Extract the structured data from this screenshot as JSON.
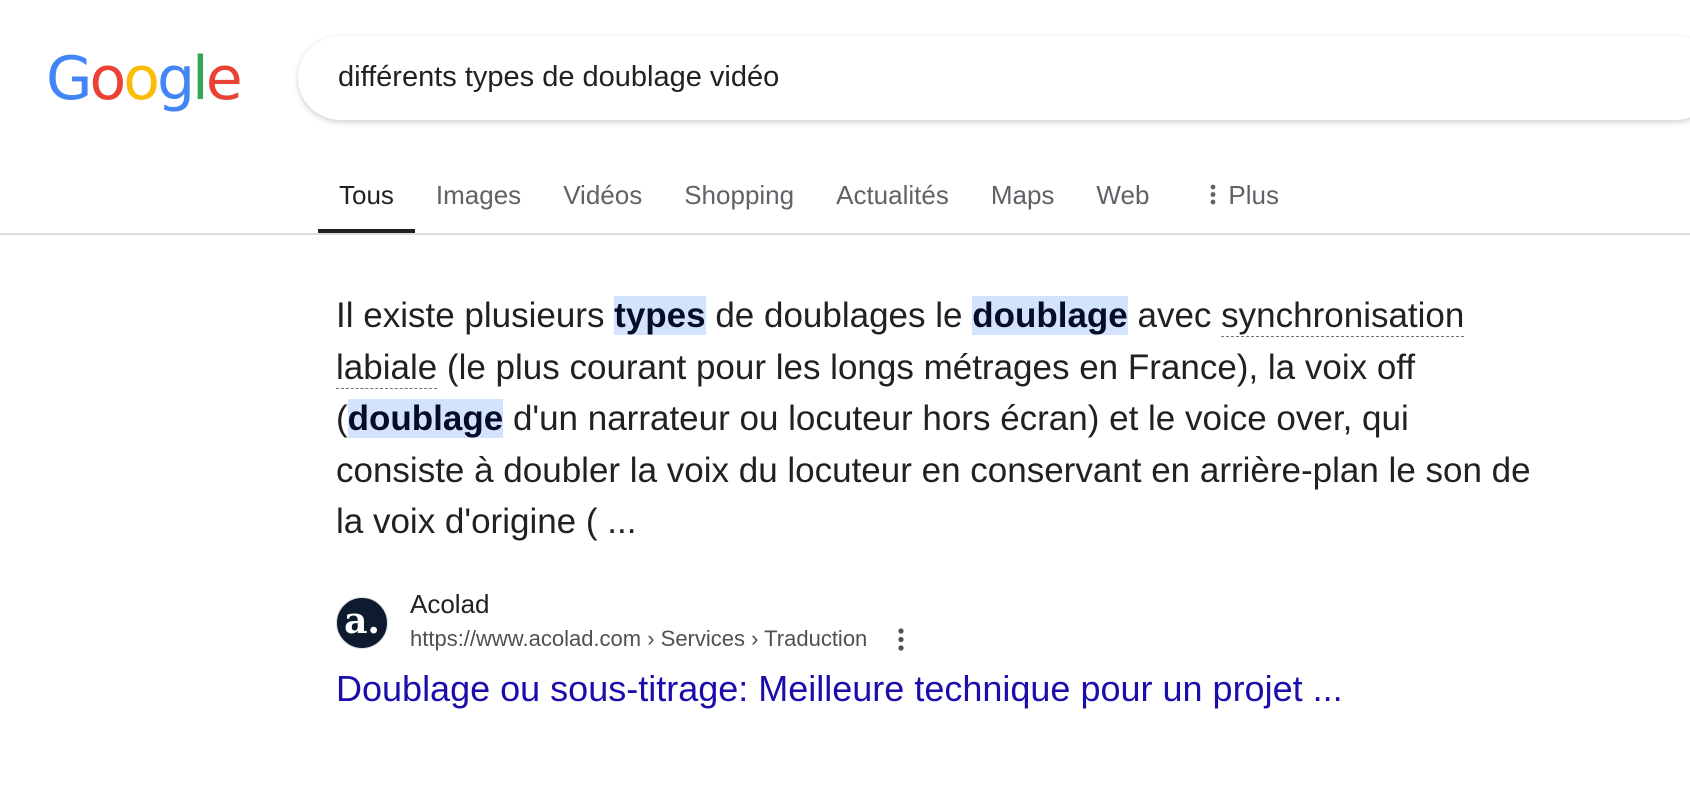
{
  "logo": {
    "letters": [
      {
        "char": "G",
        "color": "#4285f4"
      },
      {
        "char": "o",
        "color": "#ea4335"
      },
      {
        "char": "o",
        "color": "#fbbc05"
      },
      {
        "char": "g",
        "color": "#4285f4"
      },
      {
        "char": "l",
        "color": "#34a853"
      },
      {
        "char": "e",
        "color": "#ea4335"
      }
    ]
  },
  "search": {
    "query": "différents types de doublage vidéo"
  },
  "tabs": [
    {
      "label": "Tous",
      "active": true
    },
    {
      "label": "Images",
      "active": false
    },
    {
      "label": "Vidéos",
      "active": false
    },
    {
      "label": "Shopping",
      "active": false
    },
    {
      "label": "Actualités",
      "active": false
    },
    {
      "label": "Maps",
      "active": false
    },
    {
      "label": "Web",
      "active": false
    }
  ],
  "more_tab": {
    "label": "Plus",
    "icon": "vertical-dots-icon"
  },
  "snippet": {
    "segments": [
      {
        "text": "Il existe plusieurs "
      },
      {
        "text": "types",
        "highlight": true
      },
      {
        "text": " de doublages le "
      },
      {
        "text": "doublage",
        "highlight": true
      },
      {
        "text": " avec "
      },
      {
        "text": "synchronisation labiale",
        "underline": true
      },
      {
        "text": " (le plus courant pour les longs métrages en France), la voix off ("
      },
      {
        "text": "doublage",
        "highlight": true
      },
      {
        "text": " d'un narrateur ou locuteur hors écran) et le voice over, qui consiste à doubler la voix du locuteur en conservant en arrière-plan le son de la voix d'origine ( ..."
      }
    ]
  },
  "result": {
    "favicon_text": "a.",
    "favicon_bg": "#0e1a2e",
    "site_name": "Acolad",
    "url": "https://www.acolad.com › Services › Traduction",
    "menu_icon": "vertical-dots-icon",
    "title": "Doublage ou sous-titrage: Meilleure technique pour un projet ...",
    "title_color": "#1a0dab"
  }
}
